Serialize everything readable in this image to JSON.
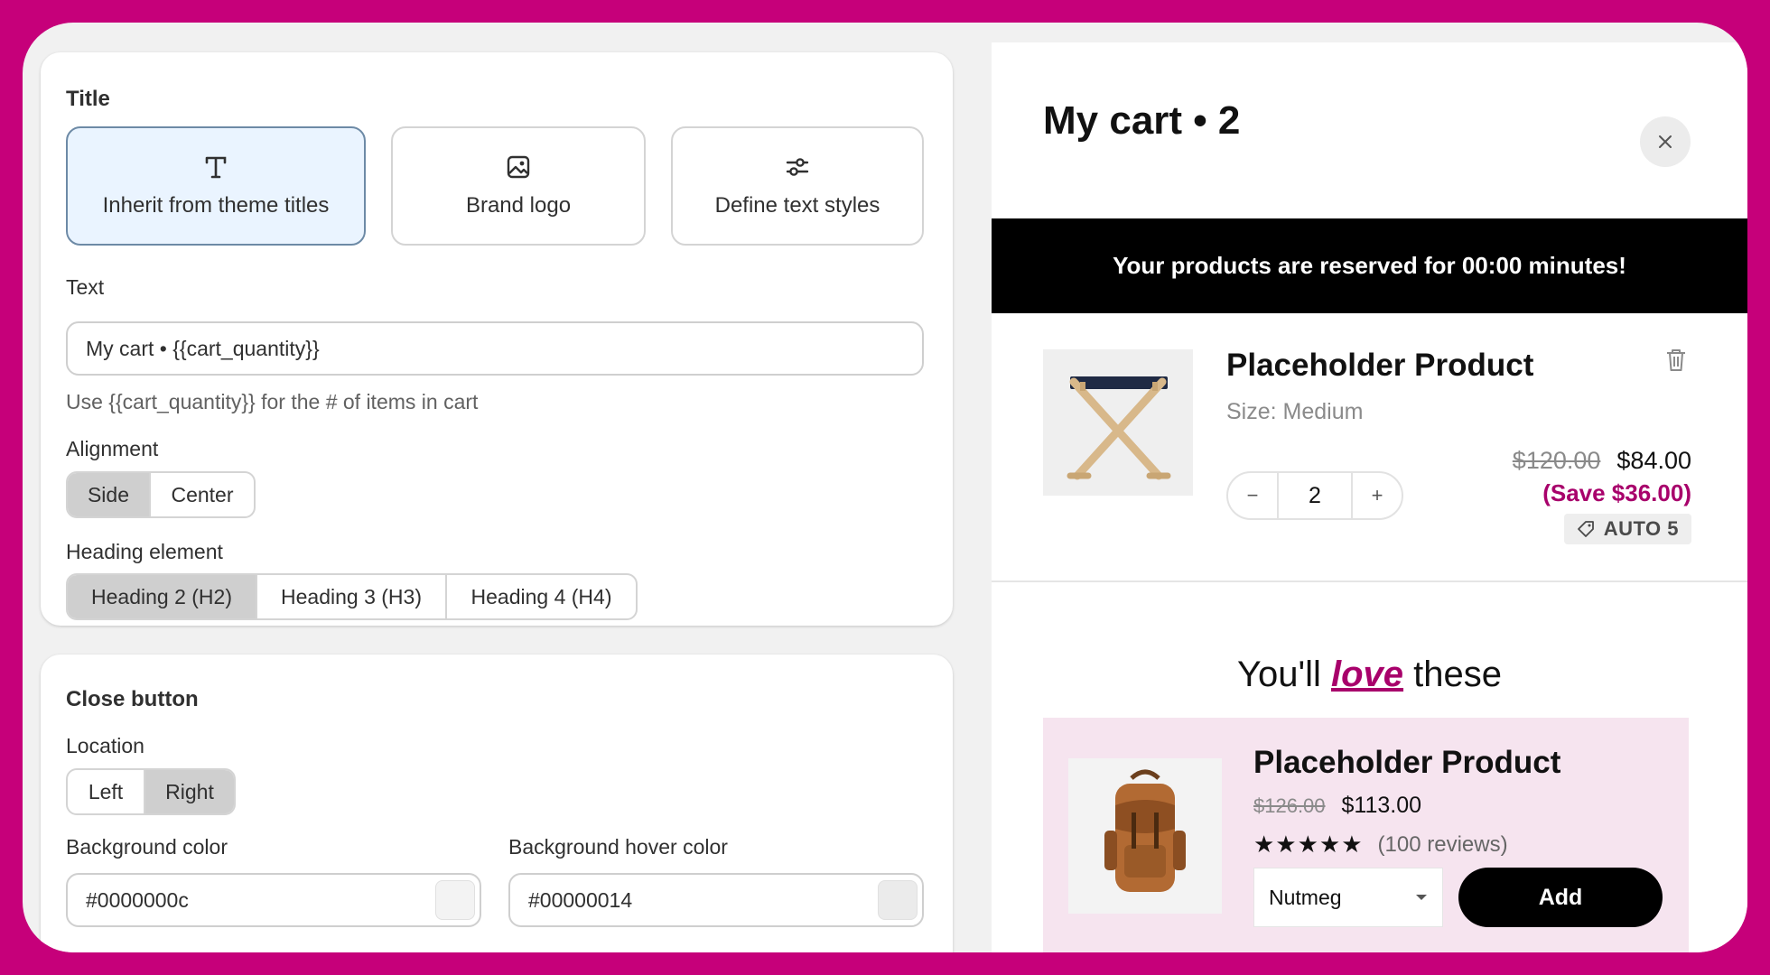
{
  "title_section": {
    "heading": "Title",
    "options": [
      {
        "label": "Inherit from theme titles",
        "icon": "text-t-icon",
        "selected": true
      },
      {
        "label": "Brand logo",
        "icon": "image-icon",
        "selected": false
      },
      {
        "label": "Define text styles",
        "icon": "sliders-icon",
        "selected": false
      }
    ],
    "text_label": "Text",
    "text_value": "My cart • {{cart_quantity}}",
    "text_hint": "Use {{cart_quantity}} for the # of items in cart",
    "alignment_label": "Alignment",
    "alignment_options": [
      "Side",
      "Center"
    ],
    "alignment_selected": "Side",
    "heading_label": "Heading element",
    "heading_options": [
      "Heading 2 (H2)",
      "Heading 3 (H3)",
      "Heading 4 (H4)"
    ],
    "heading_selected": "Heading 2 (H2)"
  },
  "close_section": {
    "heading": "Close button",
    "location_label": "Location",
    "location_options": [
      "Left",
      "Right"
    ],
    "location_selected": "Right",
    "bg_label": "Background color",
    "bg_value": "#0000000c",
    "bg_hover_label": "Background hover color",
    "bg_hover_value": "#00000014"
  },
  "cart": {
    "title": "My cart • 2",
    "banner": "Your products are reserved for 00:00 minutes!",
    "item": {
      "name": "Placeholder Product",
      "variant": "Size: Medium",
      "quantity": "2",
      "qty_minus": "−",
      "qty_plus": "+",
      "compare_price": "$120.00",
      "price": "$84.00",
      "savings": "(Save $36.00)",
      "discount_code": "AUTO 5"
    },
    "upsell": {
      "title_before": "You'll ",
      "title_emphasis": "love",
      "title_after": " these",
      "product": {
        "name": "Placeholder Product",
        "compare_price": "$126.00",
        "price": "$113.00",
        "rating": 4.5,
        "stars": "★★★★★",
        "reviews": "(100 reviews)",
        "variant": "Nutmeg",
        "add_label": "Add"
      }
    }
  },
  "colors": {
    "brand_frame": "#c6007a",
    "accent_pink": "#a8006b",
    "selected_bg": "#eaf4ff",
    "upsell_bg": "#f6e4ef"
  }
}
